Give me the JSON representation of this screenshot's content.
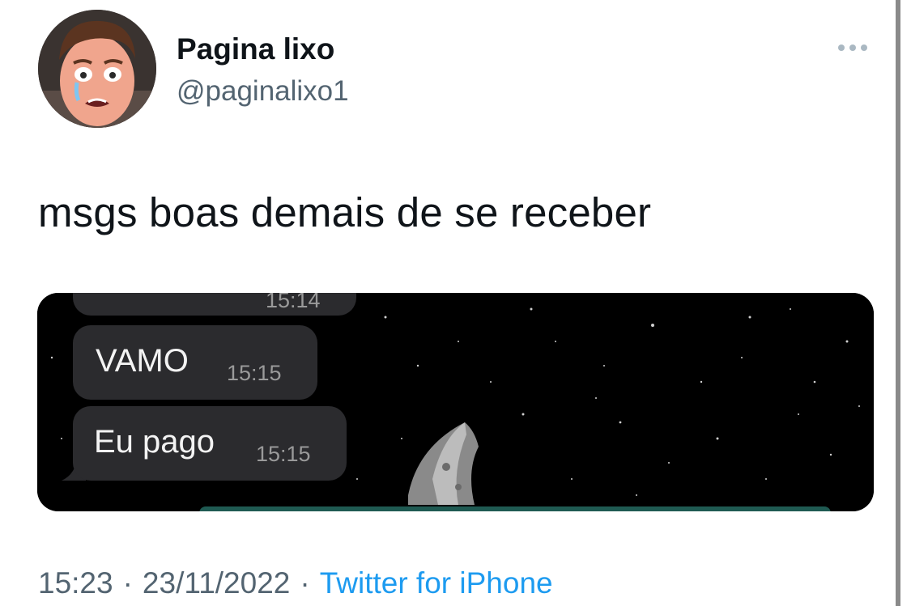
{
  "author": {
    "display_name": "Pagina lixo",
    "handle": "@paginalixo1",
    "avatar_icon": "crying-man-cartoon-avatar"
  },
  "menu": {
    "more_icon": "more-horizontal-icon"
  },
  "tweet": {
    "text": "msgs boas demais de se receber"
  },
  "media": {
    "background": "starfield-with-moon",
    "messages": [
      {
        "text": "",
        "time": "15:14"
      },
      {
        "text": "VAMO",
        "time": "15:15"
      },
      {
        "text": "Eu pago",
        "time": "15:15"
      }
    ]
  },
  "meta": {
    "time": "15:23",
    "separator": "·",
    "date": "23/11/2022",
    "source": "Twitter for iPhone"
  },
  "colors": {
    "text": "#0f1419",
    "secondary": "#536471",
    "link": "#1d9bf0",
    "bubble": "#2b2b2e",
    "media_bg": "#000000"
  }
}
